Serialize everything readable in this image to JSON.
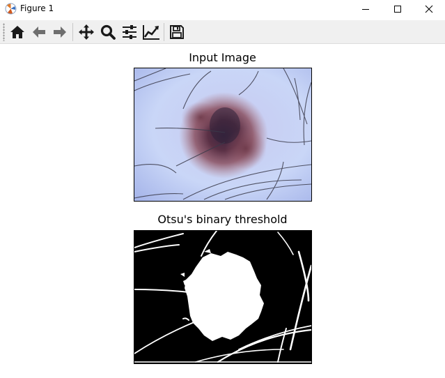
{
  "window": {
    "title": "Figure 1",
    "controls": [
      "minimize",
      "maximize",
      "close"
    ]
  },
  "toolbar": {
    "buttons": [
      {
        "name": "home",
        "icon": "home-icon"
      },
      {
        "name": "back",
        "icon": "arrow-left-icon"
      },
      {
        "name": "forward",
        "icon": "arrow-right-icon"
      },
      {
        "name": "pan",
        "icon": "move-icon"
      },
      {
        "name": "zoom",
        "icon": "magnifier-icon"
      },
      {
        "name": "configure-subplots",
        "icon": "sliders-icon"
      },
      {
        "name": "edit-axes",
        "icon": "line-chart-icon"
      },
      {
        "name": "save",
        "icon": "floppy-disk-icon"
      }
    ]
  },
  "figure": {
    "axes": [
      {
        "title": "Input Image",
        "content": "dermoscopy-image"
      },
      {
        "title": "Otsu's binary threshold",
        "content": "binary-mask"
      }
    ]
  },
  "colors": {
    "toolbar_bg": "#f0f0f0",
    "icon": "#1a1a1a",
    "icon_disabled": "#6e6e6e",
    "skin": "#c8d2f5",
    "lesion": "#5a3040"
  }
}
